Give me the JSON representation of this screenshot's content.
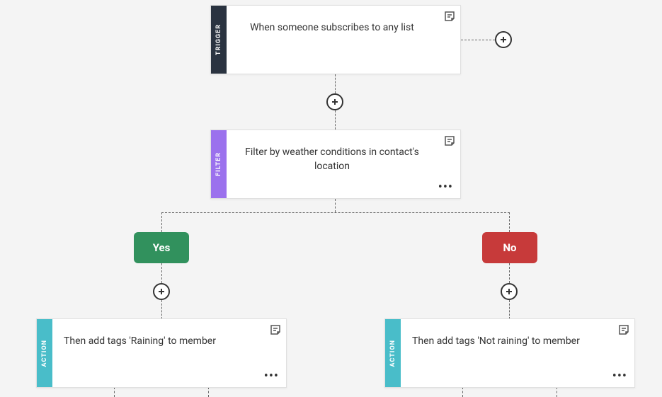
{
  "cards": {
    "trigger": {
      "tab": "TRIGGER",
      "text": "When someone subscribes to any list"
    },
    "filter": {
      "tab": "FILTER",
      "text": "Filter by weather conditions in contact's location"
    },
    "actionYes": {
      "tab": "ACTION",
      "text": "Then add tags 'Raining' to member"
    },
    "actionNo": {
      "tab": "ACTION",
      "text": "Then add tags 'Not raining' to member"
    }
  },
  "branches": {
    "yes": "Yes",
    "no": "No"
  },
  "colors": {
    "trigger": "#2a3340",
    "filter": "#9b71ed",
    "action": "#49bdc9",
    "yes": "#31915d",
    "no": "#c73a3a"
  }
}
